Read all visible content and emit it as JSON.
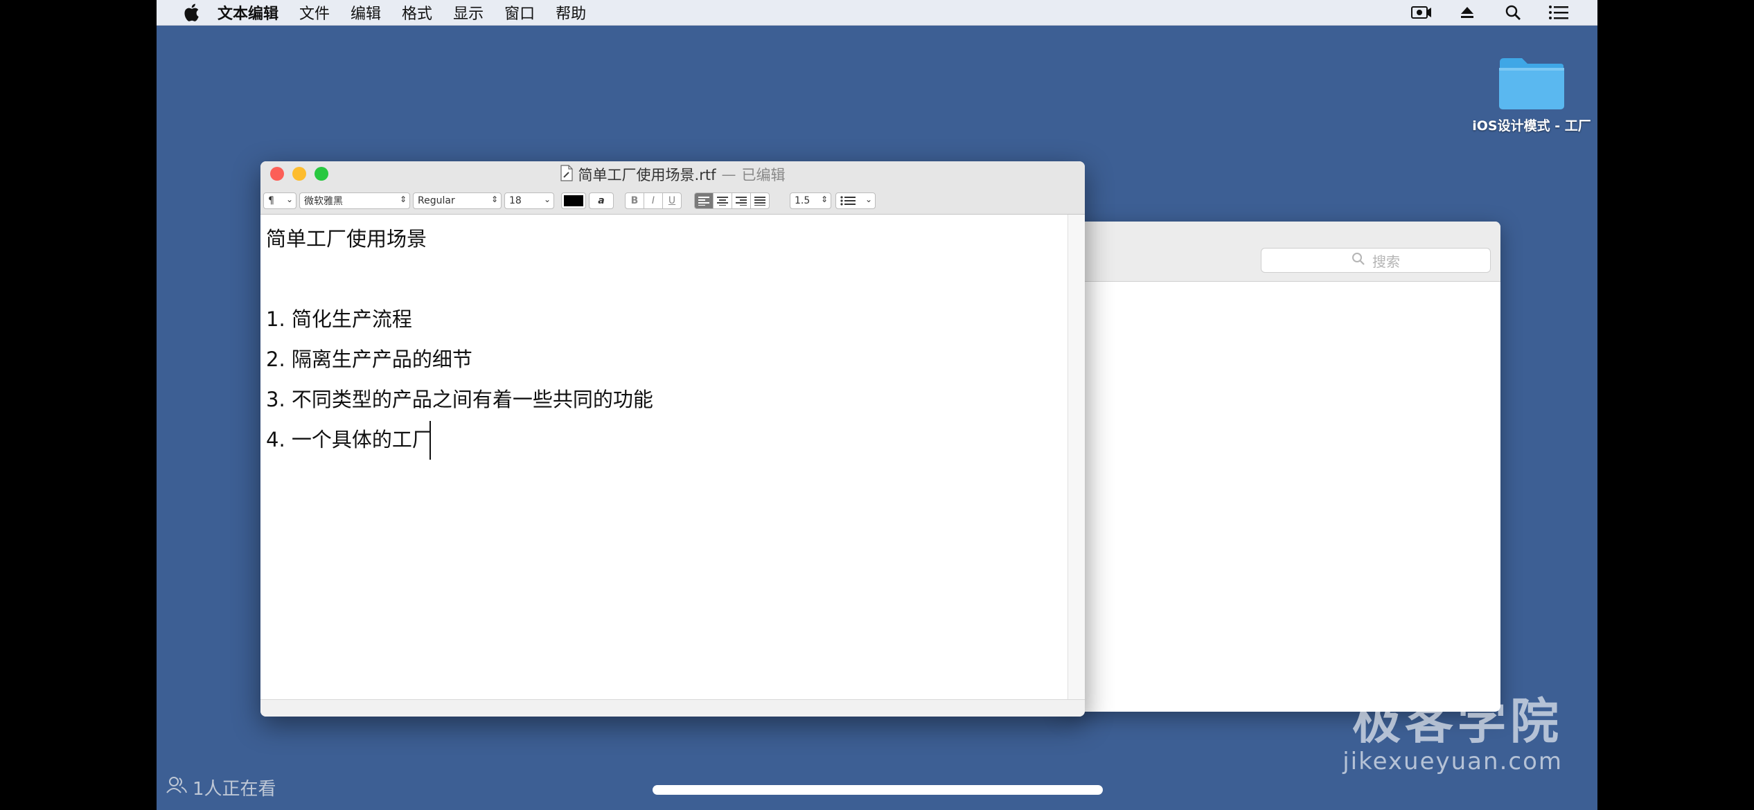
{
  "menubar": {
    "apple_icon": "apple-logo-icon",
    "items": [
      "文本编辑",
      "文件",
      "编辑",
      "格式",
      "显示",
      "窗口",
      "帮助"
    ],
    "right_icons": [
      "screen-record-icon",
      "eject-icon",
      "spotlight-search-icon",
      "notification-list-icon"
    ]
  },
  "desktop": {
    "folder_label": "iOS设计模式 - 工厂"
  },
  "finder": {
    "search_placeholder": "搜索"
  },
  "textedit": {
    "title": "简单工厂使用场景.rtf",
    "separator": "—",
    "edited": "已编辑",
    "format_bar": {
      "paragraph_style": "¶",
      "font_family": "微软雅黑",
      "font_style": "Regular",
      "font_size": "18",
      "bold": "B",
      "italic": "I",
      "underline": "U",
      "line_spacing": "1.5",
      "text_color": "#000000",
      "highlight_symbol": "a"
    },
    "document_lines": [
      "简单工厂使用场景",
      "1. 简化生产流程",
      "2. 隔离生产产品的细节",
      "3. 不同类型的产品之间有着一些共同的功能",
      "4. 一个具体的工厂"
    ]
  },
  "watermark": {
    "title": "极客学院",
    "domain": "jikexueyuan.com"
  },
  "overlay": {
    "viewers": "1人正在看"
  },
  "colors": {
    "desktop_background": "#3d5f94",
    "close": "#fc5f57",
    "minimize": "#fdbc2e",
    "zoom": "#28c840",
    "folder": "#5ab8f0"
  }
}
